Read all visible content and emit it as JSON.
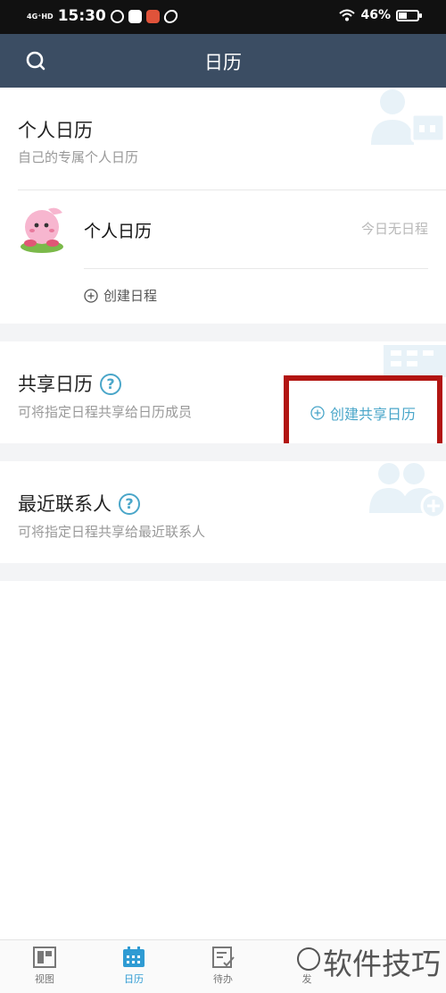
{
  "status_bar": {
    "network": "4G⁺HD",
    "time": "15:30",
    "battery": "46%",
    "battery_level": 0.46
  },
  "header": {
    "title": "日历"
  },
  "personal": {
    "title": "个人日历",
    "subtitle": "自己的专属个人日历",
    "calendar_name": "个人日历",
    "no_schedule": "今日无日程",
    "create_schedule": "创建日程"
  },
  "shared": {
    "title": "共享日历",
    "help": "?",
    "subtitle": "可将指定日程共享给日历成员",
    "create_shared": "创建共享日历"
  },
  "recent": {
    "title": "最近联系人",
    "help": "?",
    "subtitle": "可将指定日程共享给最近联系人"
  },
  "tabs": [
    {
      "label": "视图",
      "icon": "view-icon",
      "active": false
    },
    {
      "label": "日历",
      "icon": "calendar-icon",
      "active": true
    },
    {
      "label": "待办",
      "icon": "todo-icon",
      "active": false
    },
    {
      "label": "发",
      "icon": "send-icon",
      "active": false
    }
  ],
  "watermark": "软件技巧",
  "colors": {
    "header_bg": "#3b4d63",
    "accent": "#4aa6c9",
    "active_tab": "#2f9bd3",
    "highlight_box": "#b21512"
  }
}
